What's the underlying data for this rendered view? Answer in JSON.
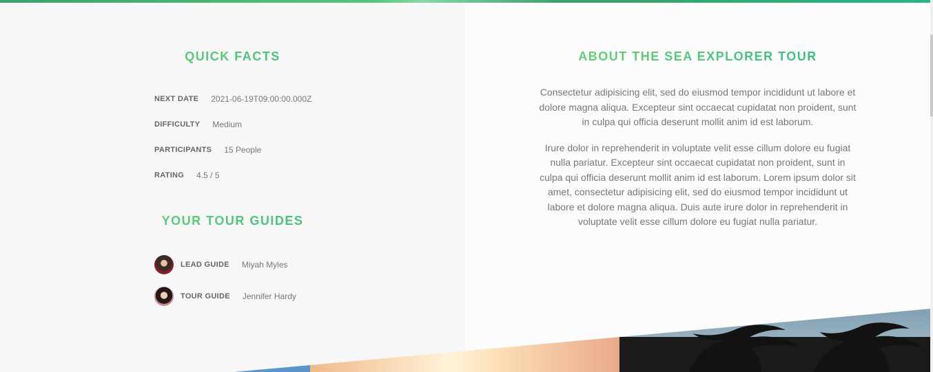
{
  "quick_facts": {
    "heading": "Quick Facts",
    "items": [
      {
        "label": "Next Date",
        "value": "2021-06-19T09:00:00.000Z"
      },
      {
        "label": "Difficulty",
        "value": "Medium"
      },
      {
        "label": "Participants",
        "value": "15 People"
      },
      {
        "label": "Rating",
        "value": "4.5 / 5"
      }
    ]
  },
  "guides": {
    "heading": "Your Tour Guides",
    "items": [
      {
        "role": "Lead Guide",
        "name": "Miyah Myles"
      },
      {
        "role": "Tour Guide",
        "name": "Jennifer Hardy"
      }
    ]
  },
  "about": {
    "heading": "About the Sea Explorer Tour",
    "paragraphs": [
      "Consectetur adipisicing elit, sed do eiusmod tempor incididunt ut labore et dolore magna aliqua. Excepteur sint occaecat cupidatat non proident, sunt in culpa qui officia deserunt mollit anim id est laborum.",
      "Irure dolor in reprehenderit in voluptate velit esse cillum dolore eu fugiat nulla pariatur. Excepteur sint occaecat cupidatat non proident, sunt in culpa qui officia deserunt mollit anim id est laborum. Lorem ipsum dolor sit amet, consectetur adipisicing elit, sed do eiusmod tempor incididunt ut labore et dolore magna aliqua. Duis aute irure dolor in reprehenderit in voluptate velit esse cillum dolore eu fugiat nulla pariatur."
    ]
  },
  "colors": {
    "accent_light": "#7dd56f",
    "accent_dark": "#28b487",
    "text": "#777777"
  }
}
